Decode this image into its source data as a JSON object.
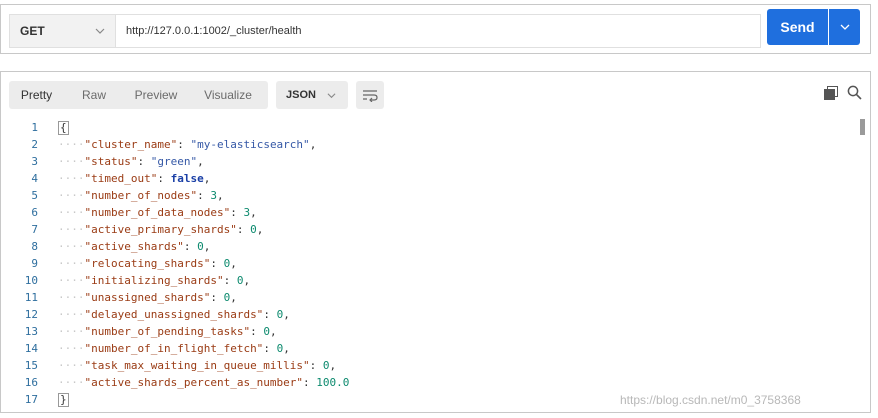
{
  "request": {
    "method": "GET",
    "url": "http://127.0.0.1:1002/_cluster/health",
    "send_label": "Send"
  },
  "response": {
    "tabs": [
      "Pretty",
      "Raw",
      "Preview",
      "Visualize"
    ],
    "active_tab": "Pretty",
    "format": "JSON",
    "open_brace": "{",
    "close_brace": "}",
    "fields": [
      {
        "key": "\"cluster_name\"",
        "value": "\"my-elasticsearch\"",
        "type": "string"
      },
      {
        "key": "\"status\"",
        "value": "\"green\"",
        "type": "string"
      },
      {
        "key": "\"timed_out\"",
        "value": "false",
        "type": "bool"
      },
      {
        "key": "\"number_of_nodes\"",
        "value": "3",
        "type": "number"
      },
      {
        "key": "\"number_of_data_nodes\"",
        "value": "3",
        "type": "number"
      },
      {
        "key": "\"active_primary_shards\"",
        "value": "0",
        "type": "number"
      },
      {
        "key": "\"active_shards\"",
        "value": "0",
        "type": "number"
      },
      {
        "key": "\"relocating_shards\"",
        "value": "0",
        "type": "number"
      },
      {
        "key": "\"initializing_shards\"",
        "value": "0",
        "type": "number"
      },
      {
        "key": "\"unassigned_shards\"",
        "value": "0",
        "type": "number"
      },
      {
        "key": "\"delayed_unassigned_shards\"",
        "value": "0",
        "type": "number"
      },
      {
        "key": "\"number_of_pending_tasks\"",
        "value": "0",
        "type": "number"
      },
      {
        "key": "\"number_of_in_flight_fetch\"",
        "value": "0",
        "type": "number"
      },
      {
        "key": "\"task_max_waiting_in_queue_millis\"",
        "value": "0",
        "type": "number"
      },
      {
        "key": "\"active_shards_percent_as_number\"",
        "value": "100.0",
        "type": "number"
      }
    ]
  },
  "watermark": "https://blog.csdn.net/m0_3758368",
  "icons": {
    "method_chevron": "chevron-down-icon",
    "send_chevron": "chevron-down-icon",
    "format_chevron": "chevron-down-icon",
    "wrap": "wrap-lines-icon",
    "copy": "copy-icon",
    "search": "search-icon"
  },
  "colors": {
    "send_button": "#1f6fde",
    "json_key": "#9a3b14",
    "json_string": "#3558a6",
    "json_number": "#0c8a6e",
    "json_bool": "#1a3fa6",
    "line_number": "#2e6e9e"
  }
}
